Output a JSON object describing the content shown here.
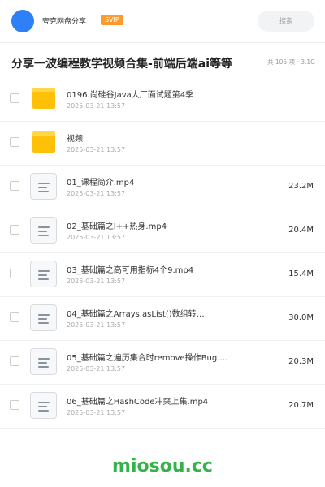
{
  "header": {
    "owner_name": "夸克网盘分享",
    "badge": "SVIP",
    "search_placeholder": "搜索"
  },
  "title_bar": {
    "title": "分享一波编程教学视频合集-前端后端ai等等",
    "summary": "共 105 项 · 3.1G"
  },
  "files": [
    {
      "type": "folder",
      "name": "0196.尚硅谷Java大厂面试题第4季",
      "date": "2025-03-21 13:57",
      "size": ""
    },
    {
      "type": "folder",
      "name": "视频",
      "date": "2025-03-21 13:57",
      "size": ""
    },
    {
      "type": "file",
      "name": "01_课程简介.mp4",
      "date": "2025-03-21 13:57",
      "size": "23.2M"
    },
    {
      "type": "file",
      "name": "02_基础篇之I++热身.mp4",
      "date": "2025-03-21 13:57",
      "size": "20.4M"
    },
    {
      "type": "file",
      "name": "03_基础篇之高可用指标4个9.mp4",
      "date": "2025-03-21 13:57",
      "size": "15.4M"
    },
    {
      "type": "file",
      "name": "04_基础篇之Arrays.asList()数组转…",
      "date": "2025-03-21 13:57",
      "size": "30.0M"
    },
    {
      "type": "file",
      "name": "05_基础篇之遍历集合时remove操作Bug.m…",
      "date": "2025-03-21 13:57",
      "size": "20.3M"
    },
    {
      "type": "file",
      "name": "06_基础篇之HashCode冲突上集.mp4",
      "date": "2025-03-21 13:57",
      "size": "20.7M"
    }
  ],
  "watermark": "miosou.cc",
  "colors": {
    "avatar": "#2f7ff7",
    "badge": "#ff9a2b",
    "folder": "#ffc107",
    "watermark": "#34b349"
  }
}
